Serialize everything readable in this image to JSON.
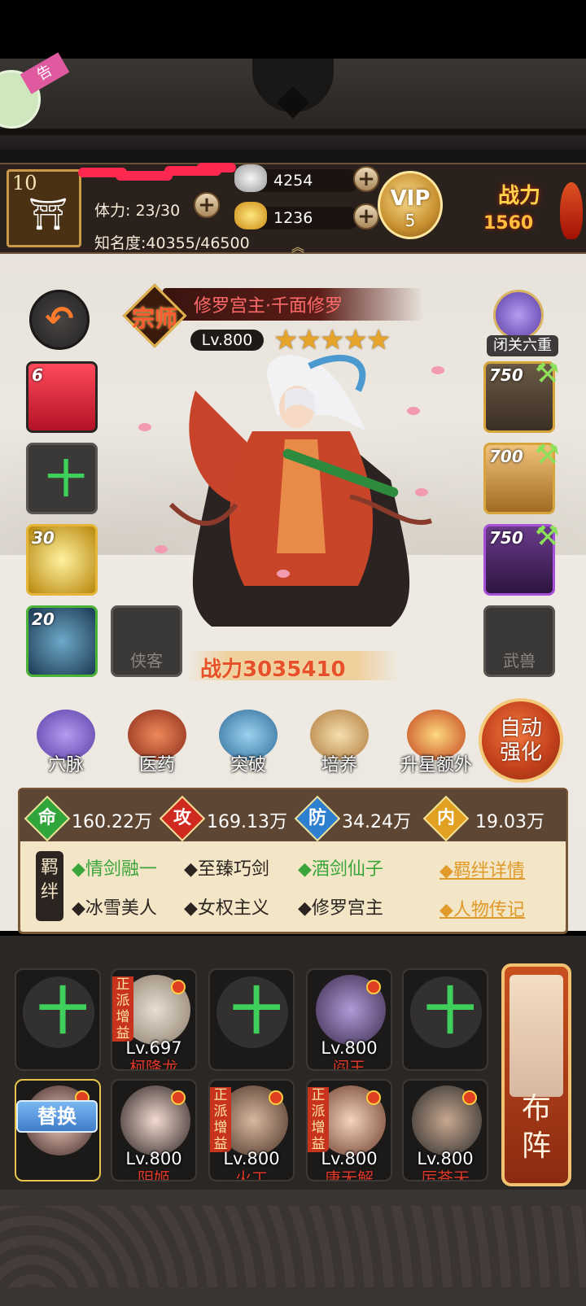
{
  "player": {
    "level": "10",
    "stamina_label": "体力:",
    "stamina_value": "23/30",
    "fame_label": "知名度:",
    "fame_value": "40355/46500"
  },
  "resources": {
    "silver": "4254",
    "gold": "1236"
  },
  "vip": {
    "label": "VIP",
    "level": "5"
  },
  "top_power": {
    "label": "战力",
    "value": "1560"
  },
  "hero": {
    "title": "修罗宫主·千面修罗",
    "rank_char": "宗师",
    "level": "Lv.800",
    "stars": 5,
    "seclusion_label": "闭关六重",
    "battle_power_label": "战力3035410"
  },
  "left_slots": [
    {
      "num": "6",
      "name": "skill-slot"
    },
    {
      "num": "",
      "name": "empty-slot"
    },
    {
      "num": "30",
      "name": "treasure-slot"
    },
    {
      "num": "20",
      "name": "compass-slot"
    }
  ],
  "right_slots": [
    {
      "num": "750",
      "name": "weapon-slot"
    },
    {
      "num": "700",
      "name": "armor-slot"
    },
    {
      "num": "750",
      "name": "accessory-slot"
    }
  ],
  "empty_labels": {
    "companion": "侠客",
    "beast": "武兽"
  },
  "functions": [
    "穴脉",
    "医药",
    "突破",
    "培养",
    "升星额外"
  ],
  "auto_button": "自动强化",
  "stats": [
    {
      "icon": "命",
      "value": "160.22万",
      "color": "#2fa53c"
    },
    {
      "icon": "攻",
      "value": "169.13万",
      "color": "#d02a20"
    },
    {
      "icon": "防",
      "value": "34.24万",
      "color": "#2f7fd0"
    },
    {
      "icon": "内",
      "value": "19.03万",
      "color": "#e0a020"
    }
  ],
  "bond_seal": "羁绊",
  "bonds_row1": [
    "◆情剑融一",
    "◆至臻巧剑",
    "◆酒剑仙子"
  ],
  "bonds_row2": [
    "◆冰雪美人",
    "◆女权主义",
    "◆修罗宫主"
  ],
  "bond_links": [
    "◆羁绊详情",
    "◆人物传记"
  ],
  "team_row1": [
    {
      "type": "empty"
    },
    {
      "type": "hero",
      "level": "Lv.697",
      "name": "柯降龙",
      "tag": "正派增益"
    },
    {
      "type": "empty"
    },
    {
      "type": "hero",
      "level": "Lv.800",
      "name": "阎王",
      "tag": ""
    },
    {
      "type": "empty"
    }
  ],
  "team_row2": [
    {
      "type": "current",
      "level": "",
      "name": "",
      "tag": ""
    },
    {
      "type": "hero",
      "level": "Lv.800",
      "name": "阴姬",
      "tag": ""
    },
    {
      "type": "hero",
      "level": "Lv.800",
      "name": "火工",
      "tag": "正派增益"
    },
    {
      "type": "hero",
      "level": "Lv.800",
      "name": "唐无解",
      "tag": "正派增益"
    },
    {
      "type": "hero",
      "level": "Lv.800",
      "name": "厉苍天",
      "tag": ""
    }
  ],
  "swap_button": "替换",
  "formation_button": "布阵",
  "colors": {
    "accent_gold": "#c99a47",
    "power_red": "#e6502a",
    "bond_green": "#3aa53a"
  }
}
